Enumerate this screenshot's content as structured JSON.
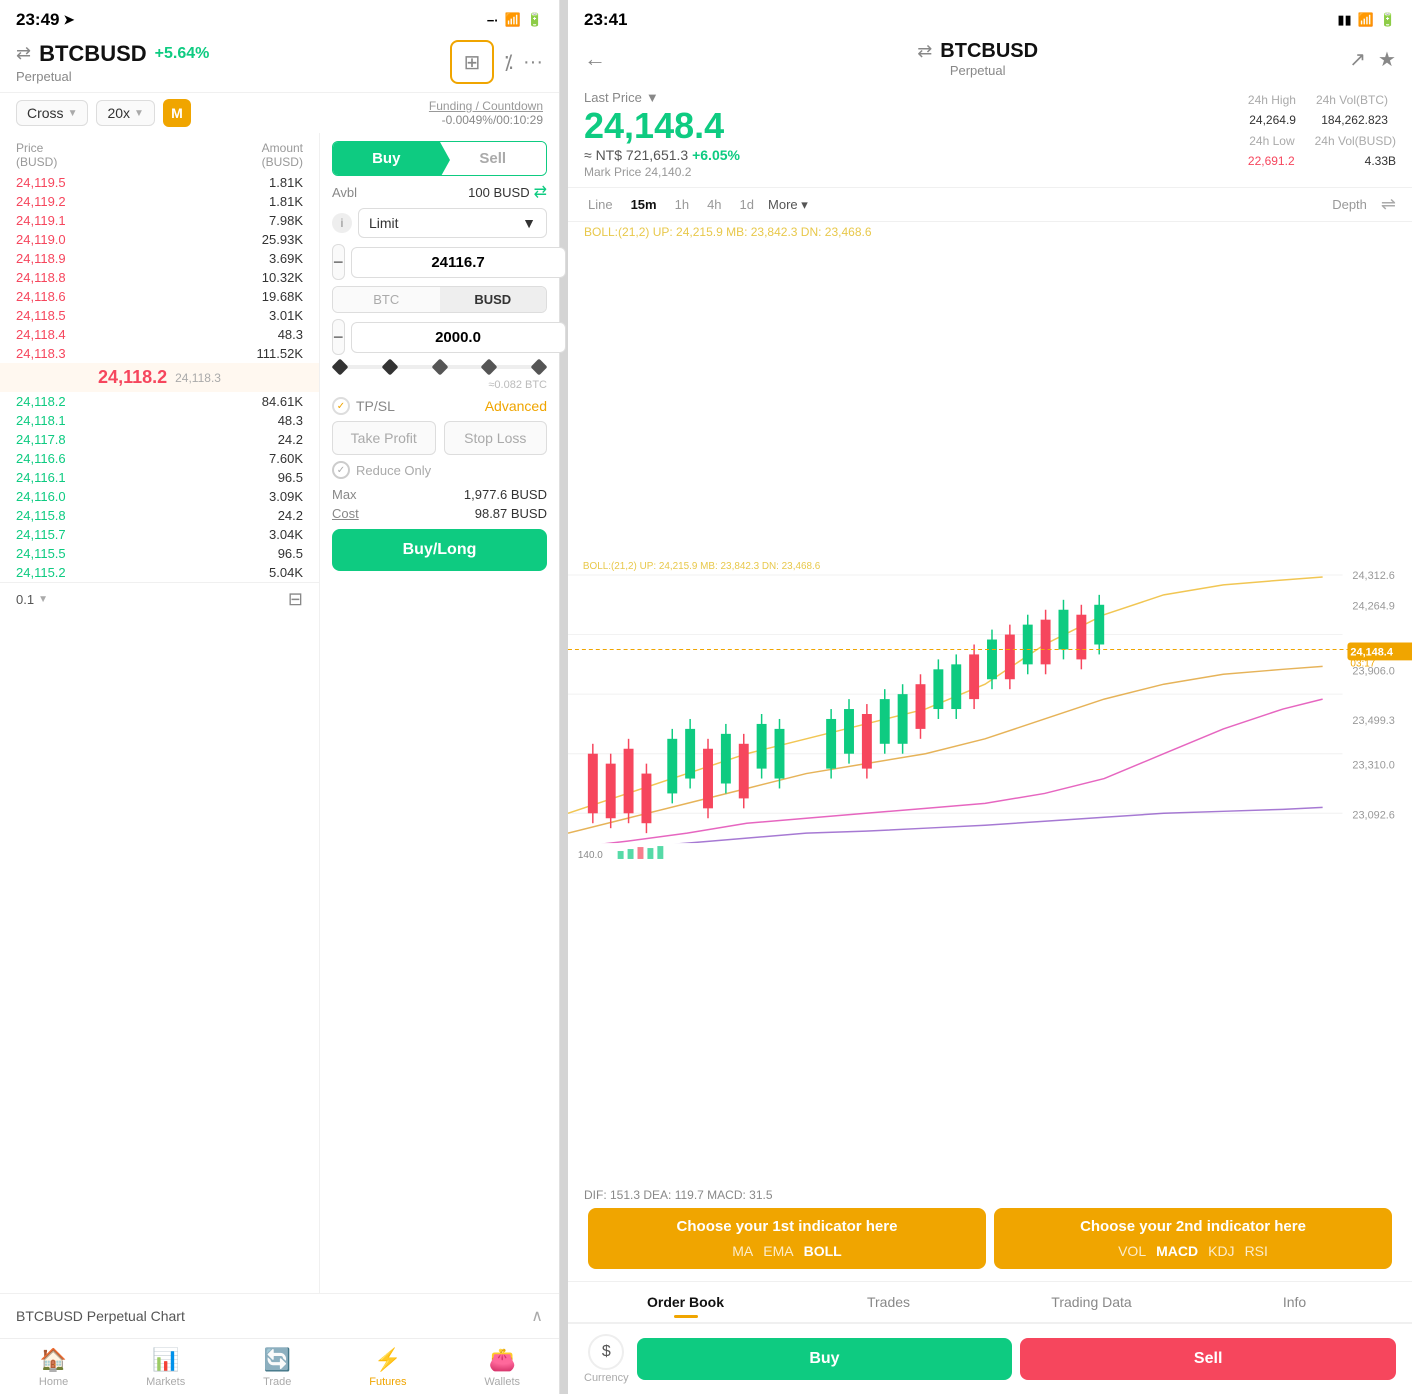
{
  "left": {
    "statusBar": {
      "time": "23:49",
      "arrow": "➤",
      "signal": "−·",
      "wifi": "⊛",
      "battery": "▮"
    },
    "symbol": "BTCBUSD",
    "change": "+5.64%",
    "type": "Perpetual",
    "leverage": "Cross",
    "leverageVal": "20x",
    "badge": "M",
    "fundingLink": "Funding / Countdown",
    "fundingVal": "-0.0049%/00:10:29",
    "orderBook": {
      "headers": [
        "Price\n(BUSD)",
        "Amount\n(BUSD)"
      ],
      "sellRows": [
        {
          "price": "24,119.5",
          "amount": "1.81K"
        },
        {
          "price": "24,119.2",
          "amount": "1.81K"
        },
        {
          "price": "24,119.1",
          "amount": "7.98K"
        },
        {
          "price": "24,119.0",
          "amount": "25.93K"
        },
        {
          "price": "24,118.9",
          "amount": "3.69K"
        },
        {
          "price": "24,118.8",
          "amount": "10.32K"
        },
        {
          "price": "24,118.6",
          "amount": "19.68K"
        },
        {
          "price": "24,118.5",
          "amount": "3.01K"
        },
        {
          "price": "24,118.4",
          "amount": "48.3"
        },
        {
          "price": "24,118.3",
          "amount": "111.52K"
        }
      ],
      "currentPrice": "24,118.2",
      "currentSub": "24,118.3",
      "buyRows": [
        {
          "price": "24,118.2",
          "amount": "84.61K"
        },
        {
          "price": "24,118.1",
          "amount": "48.3"
        },
        {
          "price": "24,117.8",
          "amount": "24.2"
        },
        {
          "price": "24,116.6",
          "amount": "7.60K"
        },
        {
          "price": "24,116.1",
          "amount": "96.5"
        },
        {
          "price": "24,116.0",
          "amount": "3.09K"
        },
        {
          "price": "24,115.8",
          "amount": "24.2"
        },
        {
          "price": "24,115.7",
          "amount": "3.04K"
        },
        {
          "price": "24,115.5",
          "amount": "96.5"
        },
        {
          "price": "24,115.2",
          "amount": "5.04K"
        }
      ]
    },
    "tradeForm": {
      "buyLabel": "Buy",
      "sellLabel": "Sell",
      "avblLabel": "Avbl",
      "avblVal": "100 BUSD",
      "orderType": "Limit",
      "price": "24116.7",
      "currencyBTC": "BTC",
      "currencyBUSD": "BUSD",
      "amount": "2000.0",
      "approxBTC": "≈0.082 BTC",
      "tpslLabel": "TP/SL",
      "advancedLabel": "Advanced",
      "takeProfitLabel": "Take Profit",
      "stopLossLabel": "Stop Loss",
      "reduceOnlyLabel": "Reduce Only",
      "maxLabel": "Max",
      "maxVal": "1,977.6 BUSD",
      "costLabel": "Cost",
      "costVal": "98.87 BUSD",
      "buyLongLabel": "Buy/Long"
    },
    "bottomChartTitle": "BTCBUSD Perpetual  Chart",
    "bottomNav": [
      {
        "icon": "🏠",
        "label": "Home"
      },
      {
        "icon": "📊",
        "label": "Markets"
      },
      {
        "icon": "🔄",
        "label": "Trade"
      },
      {
        "icon": "⚡",
        "label": "Futures",
        "active": true
      },
      {
        "icon": "👛",
        "label": "Wallets"
      }
    ],
    "tickSize": "0.1"
  },
  "right": {
    "statusBar": {
      "time": "23:41",
      "signal": "▮▮",
      "wifi": "⊛",
      "battery": "▮"
    },
    "backLabel": "←",
    "symbol": "BTCBUSD",
    "type": "Perpetual",
    "shareIcon": "↗",
    "starIcon": "★",
    "lastPriceLabel": "Last Price",
    "mainPrice": "24,148.4",
    "ntPrice": "≈ NT$ 721,651.3",
    "ntChange": "+6.05%",
    "markLabel": "Mark Price",
    "markVal": "24,140.2",
    "stats": {
      "high24h": {
        "label": "24h High",
        "val": "24,264.9"
      },
      "volBTC": {
        "label": "24h Vol(BTC)",
        "val": "184,262.823"
      },
      "low24h": {
        "label": "24h Low",
        "val": "22,691.2"
      },
      "volBUSD": {
        "label": "24h Vol(BUSD)",
        "val": "4.33B"
      }
    },
    "chartTabs": [
      "Line",
      "15m",
      "1h",
      "4h",
      "1d",
      "More ▾",
      "Depth"
    ],
    "activeTab": "15m",
    "bollLabel": "BOLL:(21,2)  UP: 24,215.9  MB: 23,842.3  DN: 23,468.6",
    "chartPrices": [
      "24,312.6",
      "24,264.9",
      "24,148.4",
      "03:17",
      "23,906.0",
      "23,499.3",
      "23,310.0",
      "23,092.6",
      "140.0"
    ],
    "priceBadgeVal": "24,148.4",
    "priceBadgeTime": "03:17",
    "macdLabel": "DIF: 151.3  DEA: 119.7  MACD: 31.5",
    "indicators": {
      "first": {
        "title": "Choose your 1st indicator here",
        "options": [
          "MA",
          "EMA",
          "BOLL"
        ],
        "active": "BOLL"
      },
      "second": {
        "title": "Choose your 2nd indicator here",
        "options": [
          "VOL",
          "MACD",
          "KDJ",
          "RSI"
        ],
        "active": "MACD"
      }
    },
    "bottomTabs": [
      "Order Book",
      "Trades",
      "Trading Data",
      "Info"
    ],
    "activeBottomTab": "Order Book",
    "currencyLabel": "Currency",
    "buyLabel": "Buy",
    "sellLabel": "Sell"
  }
}
